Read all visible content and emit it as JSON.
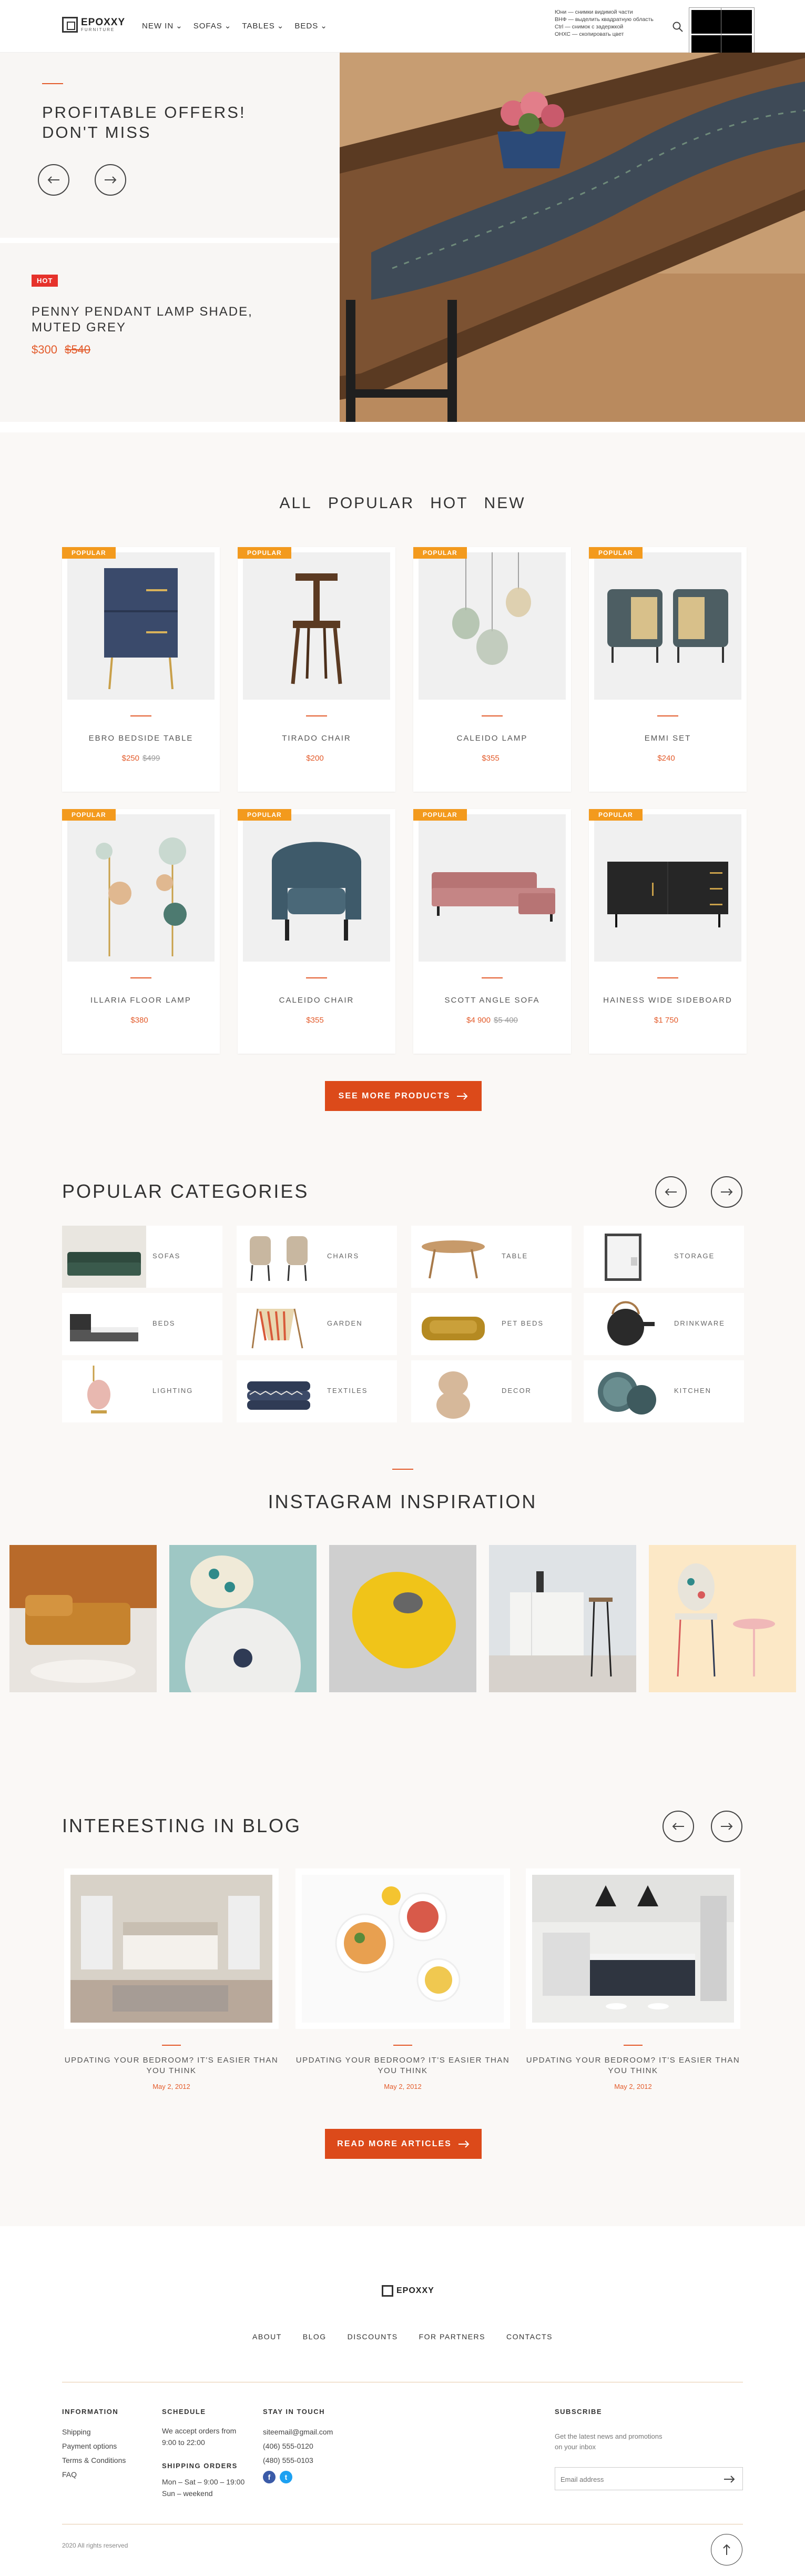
{
  "header": {
    "brand": "EPOXXY",
    "brand_tagline": "FURNITURE",
    "nav": [
      "NEW IN",
      "SOFAS",
      "TABLES",
      "BEDS"
    ],
    "cookie_lines": [
      "Юни — снимки видимой части",
      "ВНФ — выделить квадратную область",
      "Ctrl — снимок с задержкой",
      "ОНХС — скопировать цвет"
    ]
  },
  "hero": {
    "offer_title": "PROFITABLE OFFERS!\nDON'T MISS",
    "product_badge": "HOT",
    "product_name": "PENNY PENDANT LAMP SHADE,\nMUTED GREY",
    "product_price": "$300",
    "product_old_price": "$540"
  },
  "products": {
    "tabs": [
      "ALL",
      "POPULAR",
      "HOT",
      "NEW"
    ],
    "items": [
      {
        "badge": "POPULAR",
        "name": "EBRO BEDSIDE TABLE",
        "price": "$250",
        "old_price": "$499"
      },
      {
        "badge": "POPULAR",
        "name": "TIRADO CHAIR",
        "price": "$200",
        "old_price": ""
      },
      {
        "badge": "POPULAR",
        "name": "CALEIDO LAMP",
        "price": "$355",
        "old_price": ""
      },
      {
        "badge": "POPULAR",
        "name": "EMMI SET",
        "price": "$240",
        "old_price": ""
      },
      {
        "badge": "POPULAR",
        "name": "ILLARIA FLOOR LAMP",
        "price": "$380",
        "old_price": ""
      },
      {
        "badge": "POPULAR",
        "name": "CALEIDO CHAIR",
        "price": "$355",
        "old_price": ""
      },
      {
        "badge": "POPULAR",
        "name": "SCOTT ANGLE SOFA",
        "price": "$4 900",
        "old_price": "$5 400"
      },
      {
        "badge": "POPULAR",
        "name": "HAINESS WIDE SIDEBOARD",
        "price": "$1 750",
        "old_price": ""
      }
    ],
    "see_more": "SEE MORE PRODUCTS"
  },
  "categories": {
    "title": "POPULAR CATEGORIES",
    "items": [
      "SOFAS",
      "CHAIRS",
      "TABLE",
      "STORAGE",
      "BEDS",
      "GARDEN",
      "PET BEDS",
      "DRINKWARE",
      "LIGHTING",
      "TEXTILES",
      "DECOR",
      "KITCHEN"
    ]
  },
  "instagram": {
    "title": "INSTAGRAM INSPIRATION"
  },
  "blog": {
    "title": "INTERESTING IN BLOG",
    "posts": [
      {
        "title": "UPDATING YOUR BEDROOM? IT'S EASIER THAN YOU THINK",
        "date": "May 2, 2012"
      },
      {
        "title": "UPDATING YOUR BEDROOM? IT'S EASIER THAN YOU THINK",
        "date": "May 2, 2012"
      },
      {
        "title": "UPDATING YOUR BEDROOM? IT'S EASIER THAN YOU THINK",
        "date": "May 2, 2012"
      }
    ],
    "read_more": "READ MORE ARTICLES"
  },
  "footer": {
    "brand": "EPOXXY",
    "menu": [
      "ABOUT",
      "BLOG",
      "DISCOUNTS",
      "FOR PARTNERS",
      "CONTACTS"
    ],
    "info_head": "INFORMATION",
    "info_links": [
      "Shipping",
      "Payment options",
      "Terms & Conditions",
      "FAQ"
    ],
    "schedule_head": "SCHEDULE",
    "schedule_text": "We accept orders from\n9:00 to 22:00",
    "shipping_head": "SHIPPING ORDERS",
    "shipping_text": "Mon – Sat – 9:00 – 19:00\nSun – weekend",
    "touch_head": "STAY IN TOUCH",
    "email": "siteemail@gmail.com",
    "phone1": "(406) 555-0120",
    "phone2": "(480) 555-0103",
    "subscribe_head": "SUBSCRIBE",
    "subscribe_text": "Get the latest news and promotions\non your inbox",
    "email_placeholder": "Email address",
    "copyright": "2020 All rights reserved"
  },
  "colors": {
    "accent": "#dc4a1a",
    "badge": "#f39a1d",
    "hot": "#e6322b"
  }
}
